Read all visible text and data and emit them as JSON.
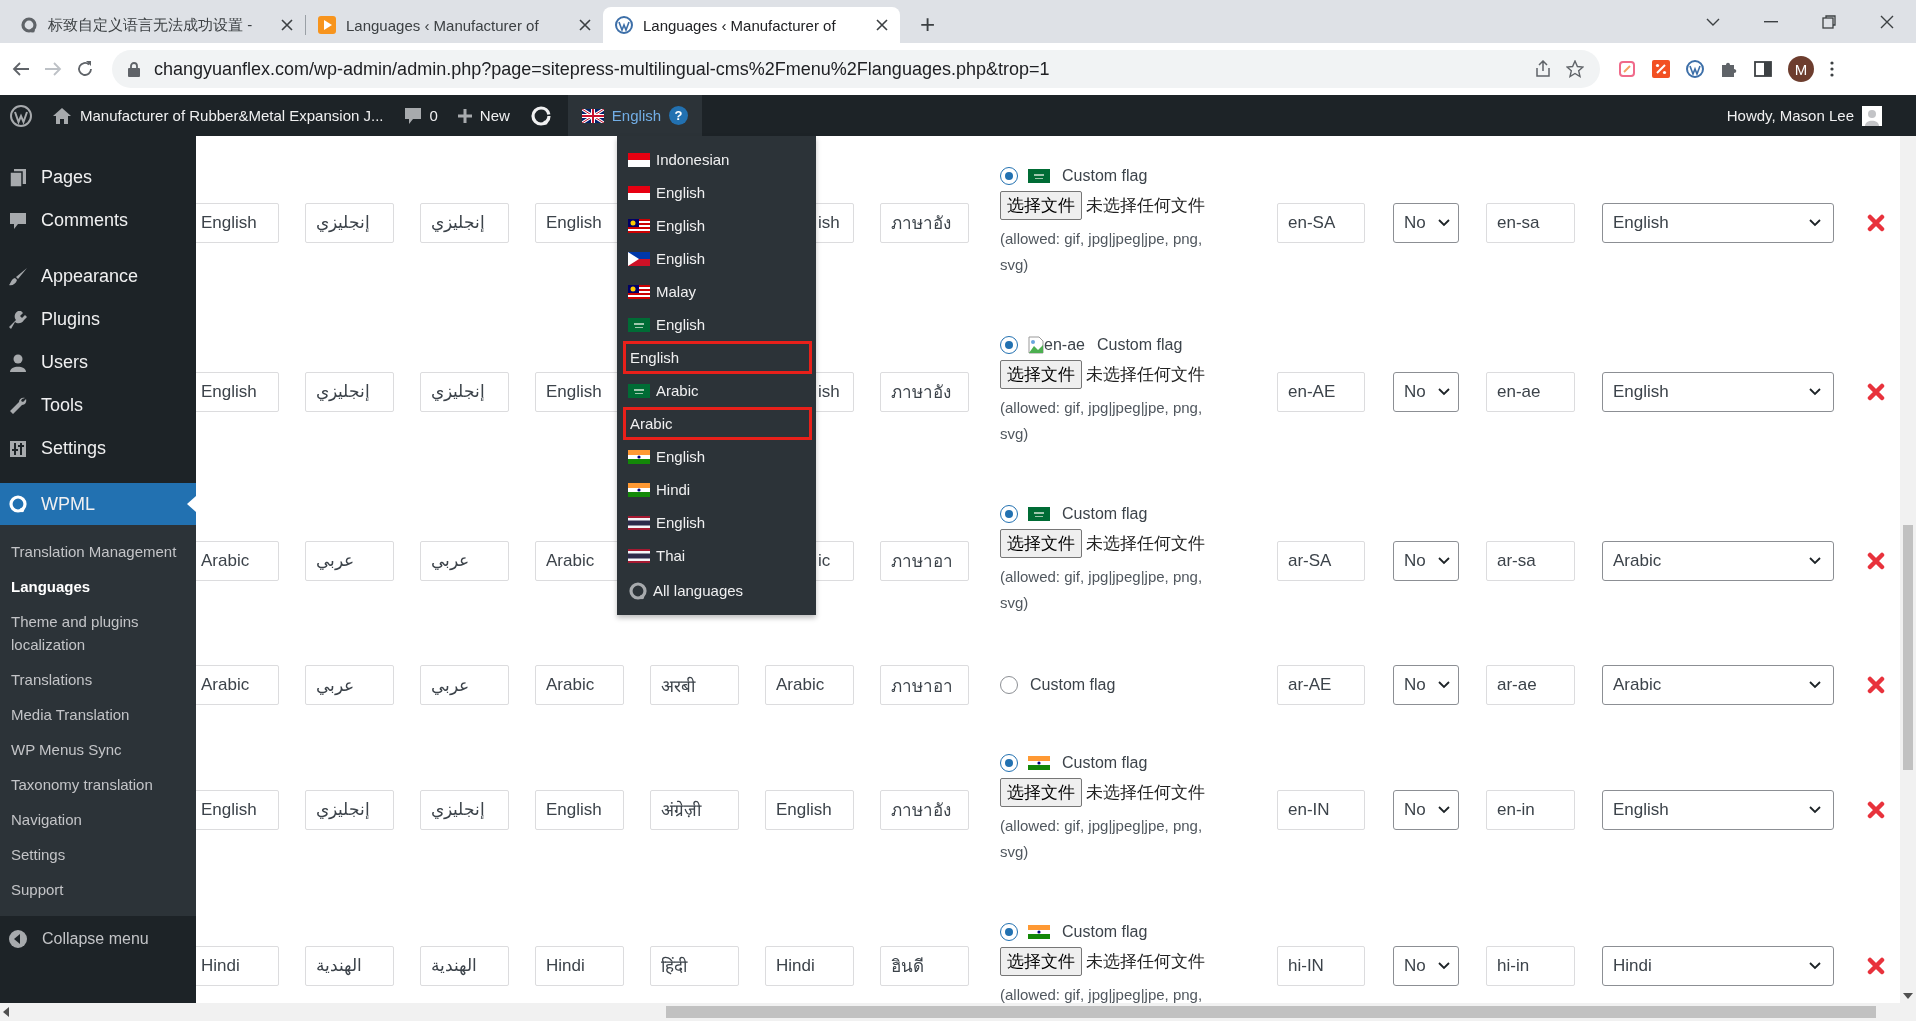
{
  "browser": {
    "tabs": [
      {
        "title": "标致自定义语言无法成功设置 -",
        "selected": false
      },
      {
        "title": "Languages ‹ Manufacturer of",
        "selected": false
      },
      {
        "title": "Languages ‹ Manufacturer of",
        "selected": true
      }
    ],
    "new_tab": "+",
    "url": "changyuanflex.com/wp-admin/admin.php?page=sitepress-multilingual-cms%2Fmenu%2Flanguages.php&trop=1",
    "profile": "M"
  },
  "admin_bar": {
    "site_title": "Manufacturer of Rubber&Metal Expansion J...",
    "comments": "0",
    "new": "New",
    "language": "English",
    "help": "?",
    "greeting": "Howdy, Mason Lee"
  },
  "sidebar": {
    "items": [
      {
        "label": "Pages",
        "selected": false
      },
      {
        "label": "Comments",
        "selected": false
      },
      {
        "label": "Appearance",
        "selected": false
      },
      {
        "label": "Plugins",
        "selected": false
      },
      {
        "label": "Users",
        "selected": false
      },
      {
        "label": "Tools",
        "selected": false
      },
      {
        "label": "Settings",
        "selected": false
      },
      {
        "label": "WPML",
        "selected": true
      }
    ],
    "submenu": [
      {
        "label": "Translation Management",
        "selected": false
      },
      {
        "label": "Languages",
        "selected": true
      },
      {
        "label": "Theme and plugins localization",
        "selected": false
      },
      {
        "label": "Translations",
        "selected": false
      },
      {
        "label": "Media Translation",
        "selected": false
      },
      {
        "label": "WP Menus Sync",
        "selected": false
      },
      {
        "label": "Taxonomy translation",
        "selected": false
      },
      {
        "label": "Navigation",
        "selected": false
      },
      {
        "label": "Settings",
        "selected": false
      },
      {
        "label": "Support",
        "selected": false
      }
    ],
    "collapse": "Collapse menu"
  },
  "language_menu": {
    "items": [
      {
        "label": "Indonesian",
        "marked": false
      },
      {
        "label": "English",
        "marked": false
      },
      {
        "label": "English",
        "marked": false
      },
      {
        "label": "English",
        "marked": false
      },
      {
        "label": "Malay",
        "marked": false
      },
      {
        "label": "English",
        "marked": false
      },
      {
        "label": "English",
        "marked": true
      },
      {
        "label": "Arabic",
        "marked": false
      },
      {
        "label": "Arabic",
        "marked": true
      },
      {
        "label": "English",
        "marked": false
      },
      {
        "label": "Hindi",
        "marked": false
      },
      {
        "label": "English",
        "marked": false
      },
      {
        "label": "Thai",
        "marked": false
      }
    ],
    "all": "All languages"
  },
  "rows": [
    {
      "cells": [
        "English",
        "إنجليزي",
        "إنجليزي",
        "English",
        null,
        {
          "text": "ish",
          "covered": true
        },
        "ภาษาอัง"
      ],
      "flag": {
        "selected": true,
        "kind": "sa",
        "label": "Custom flag"
      },
      "upload": {
        "button": "选择文件",
        "status": "未选择任何文件",
        "note": "(allowed: gif, jpg|jpeg|jpe, png, svg)"
      },
      "column_9": "en-SA",
      "column_10": "No",
      "column_11": "en-sa",
      "column_12": "English"
    },
    {
      "cells": [
        "English",
        "إنجليزي",
        "إنجليزي",
        "English",
        null,
        {
          "text": "ish",
          "covered": true
        },
        "ภาษาอัง"
      ],
      "flag": {
        "selected": true,
        "kind": "broken",
        "alt": "en-ae",
        "label": "Custom flag"
      },
      "upload": {
        "button": "选择文件",
        "status": "未选择任何文件",
        "note": "(allowed: gif, jpg|jpeg|jpe, png, svg)"
      },
      "column_9": "en-AE",
      "column_10": "No",
      "column_11": "en-ae",
      "column_12": "English"
    },
    {
      "cells": [
        "Arabic",
        "عربي",
        "عربي",
        "Arabic",
        null,
        {
          "text": "ic",
          "covered": true
        },
        "ภาษาอา"
      ],
      "flag": {
        "selected": true,
        "kind": "sa",
        "label": "Custom flag"
      },
      "upload": {
        "button": "选择文件",
        "status": "未选择任何文件",
        "note": "(allowed: gif, jpg|jpeg|jpe, png, svg)"
      },
      "column_9": "ar-SA",
      "column_10": "No",
      "column_11": "ar-sa",
      "column_12": "Arabic"
    },
    {
      "cells": [
        "Arabic",
        "عربي",
        "عربي",
        "Arabic",
        "अरबी",
        "Arabic",
        "ภาษาอา"
      ],
      "flag": {
        "selected": false,
        "kind": "none",
        "label": "Custom flag"
      },
      "column_9": "ar-AE",
      "column_10": "No",
      "column_11": "ar-ae",
      "column_12": "Arabic"
    },
    {
      "cells": [
        "English",
        "إنجليزي",
        "إنجليزي",
        "English",
        "अंग्रेज़ी",
        "English",
        "ภาษาอัง"
      ],
      "flag": {
        "selected": true,
        "kind": "in",
        "label": "Custom flag"
      },
      "upload": {
        "button": "选择文件",
        "status": "未选择任何文件",
        "note": "(allowed: gif, jpg|jpeg|jpe, png, svg)"
      },
      "column_9": "en-IN",
      "column_10": "No",
      "column_11": "en-in",
      "column_12": "English"
    },
    {
      "cells": [
        "Hindi",
        "الهندية",
        "الهندية",
        "Hindi",
        "हिंदी",
        "Hindi",
        "ฮินดี"
      ],
      "flag": {
        "selected": true,
        "kind": "in",
        "label": "Custom flag"
      },
      "upload": {
        "button": "选择文件",
        "status": "未选择任何文件",
        "note": "(allowed: gif, jpg|jpeg|jpe, png,"
      },
      "column_9": "hi-IN",
      "column_10": "No",
      "column_11": "hi-in",
      "column_12": "Hindi"
    }
  ]
}
